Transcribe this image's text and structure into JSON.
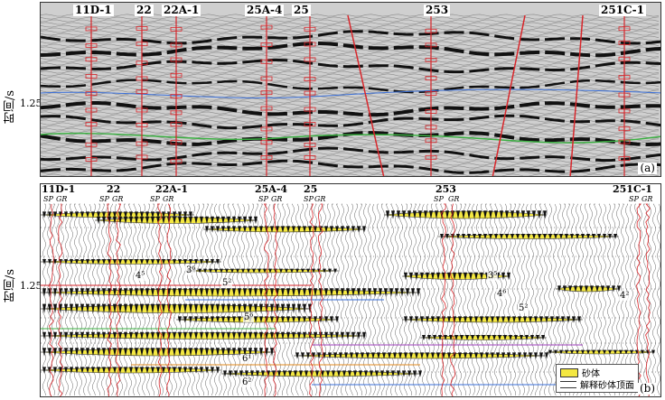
{
  "figure": {
    "y_axis_label": "时间/s",
    "y_tick": "1.25",
    "panel_a_tag": "(a)",
    "panel_b_tag": "(b)"
  },
  "wells_a": [
    "11D-1",
    "22",
    "22A-1",
    "25A-4",
    "25",
    "253",
    "251C-1"
  ],
  "wells_b": [
    "11D-1",
    "22",
    "22A-1",
    "25A-4",
    "25",
    "253",
    "251C-1"
  ],
  "curves": {
    "sp": "SP",
    "gr": "GR"
  },
  "sand_labels": [
    "4⁵",
    "3⁶",
    "5²",
    "5⁶",
    "6¹",
    "6²",
    "3⁵",
    "4⁶",
    "5²",
    "4²"
  ],
  "legend": {
    "sand": "砂体",
    "top": "解释砂体顶面"
  },
  "colors": {
    "sand": "#f4e842",
    "well_line": "#d8262b",
    "green_horizon": "#3cb043",
    "blue_horizon": "#3a6fd8"
  }
}
